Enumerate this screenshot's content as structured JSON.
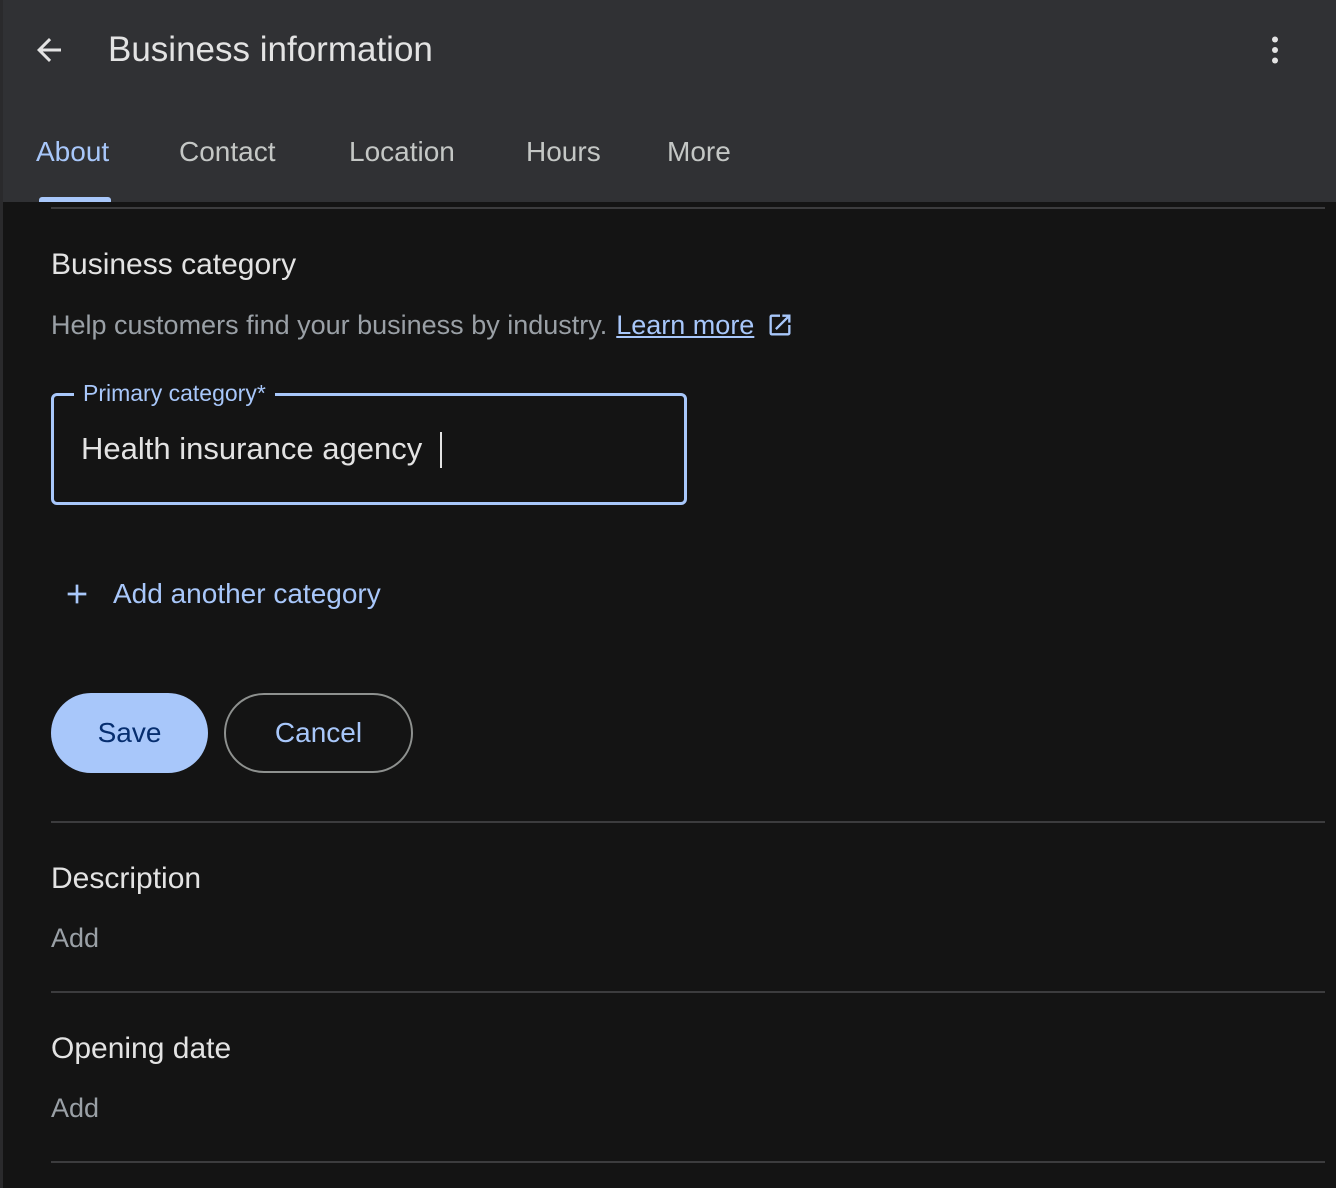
{
  "header": {
    "title": "Business information",
    "tabs": [
      {
        "label": "About",
        "active": true
      },
      {
        "label": "Contact",
        "active": false
      },
      {
        "label": "Location",
        "active": false
      },
      {
        "label": "Hours",
        "active": false
      },
      {
        "label": "More",
        "active": false
      }
    ]
  },
  "category_section": {
    "title": "Business category",
    "helper": "Help customers find your business by industry.",
    "learn_more": "Learn more",
    "field_label": "Primary category*",
    "field_value": "Health insurance agency",
    "add_another": "Add another category",
    "save_label": "Save",
    "cancel_label": "Cancel"
  },
  "description_section": {
    "title": "Description",
    "add_label": "Add"
  },
  "opening_date_section": {
    "title": "Opening date",
    "add_label": "Add"
  },
  "colors": {
    "accent": "#a8c7fa",
    "header_bg": "#303134",
    "panel_bg": "#141414"
  }
}
